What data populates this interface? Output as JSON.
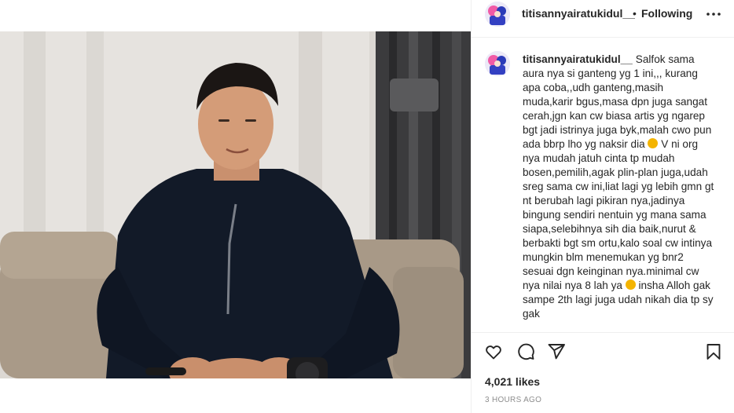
{
  "post": {
    "username": "titisannyairatukidul__",
    "dot": "•",
    "follow_status": "Following",
    "caption_username": "titisannyairatukidul__",
    "caption_part1": "Salfok sama aura nya si ganteng yg 1 ini,,, kurang apa coba,,udh ganteng,masih muda,karir bgus,masa dpn juga sangat cerah,jgn kan cw biasa artis yg ngarep bgt jadi istrinya juga byk,malah cwo pun ada bbrp lho yg naksir dia",
    "caption_part2": "V ni org nya mudah jatuh cinta tp mudah bosen,pemilih,agak plin-plan juga,udah sreg sama cw ini,liat lagi yg lebih gmn gt nt berubah lagi pikiran nya,jadinya bingung sendiri nentuin yg mana sama siapa,selebihnya sih dia baik,nurut & berbakti bgt sm ortu,kalo soal cw intinya mungkin blm menemukan yg bnr2 sesuai dgn keinginan nya.minimal cw nya nilai nya 8 lah ya",
    "caption_part3": "insha Alloh gak sampe 2th lagi juga udah nikah dia tp sy gak",
    "likes": "4,021 likes",
    "time": "3 HOURS AGO"
  },
  "icons": {
    "more": "more-options-icon",
    "like": "heart-icon",
    "comment": "comment-icon",
    "share": "share-icon",
    "save": "bookmark-icon"
  }
}
